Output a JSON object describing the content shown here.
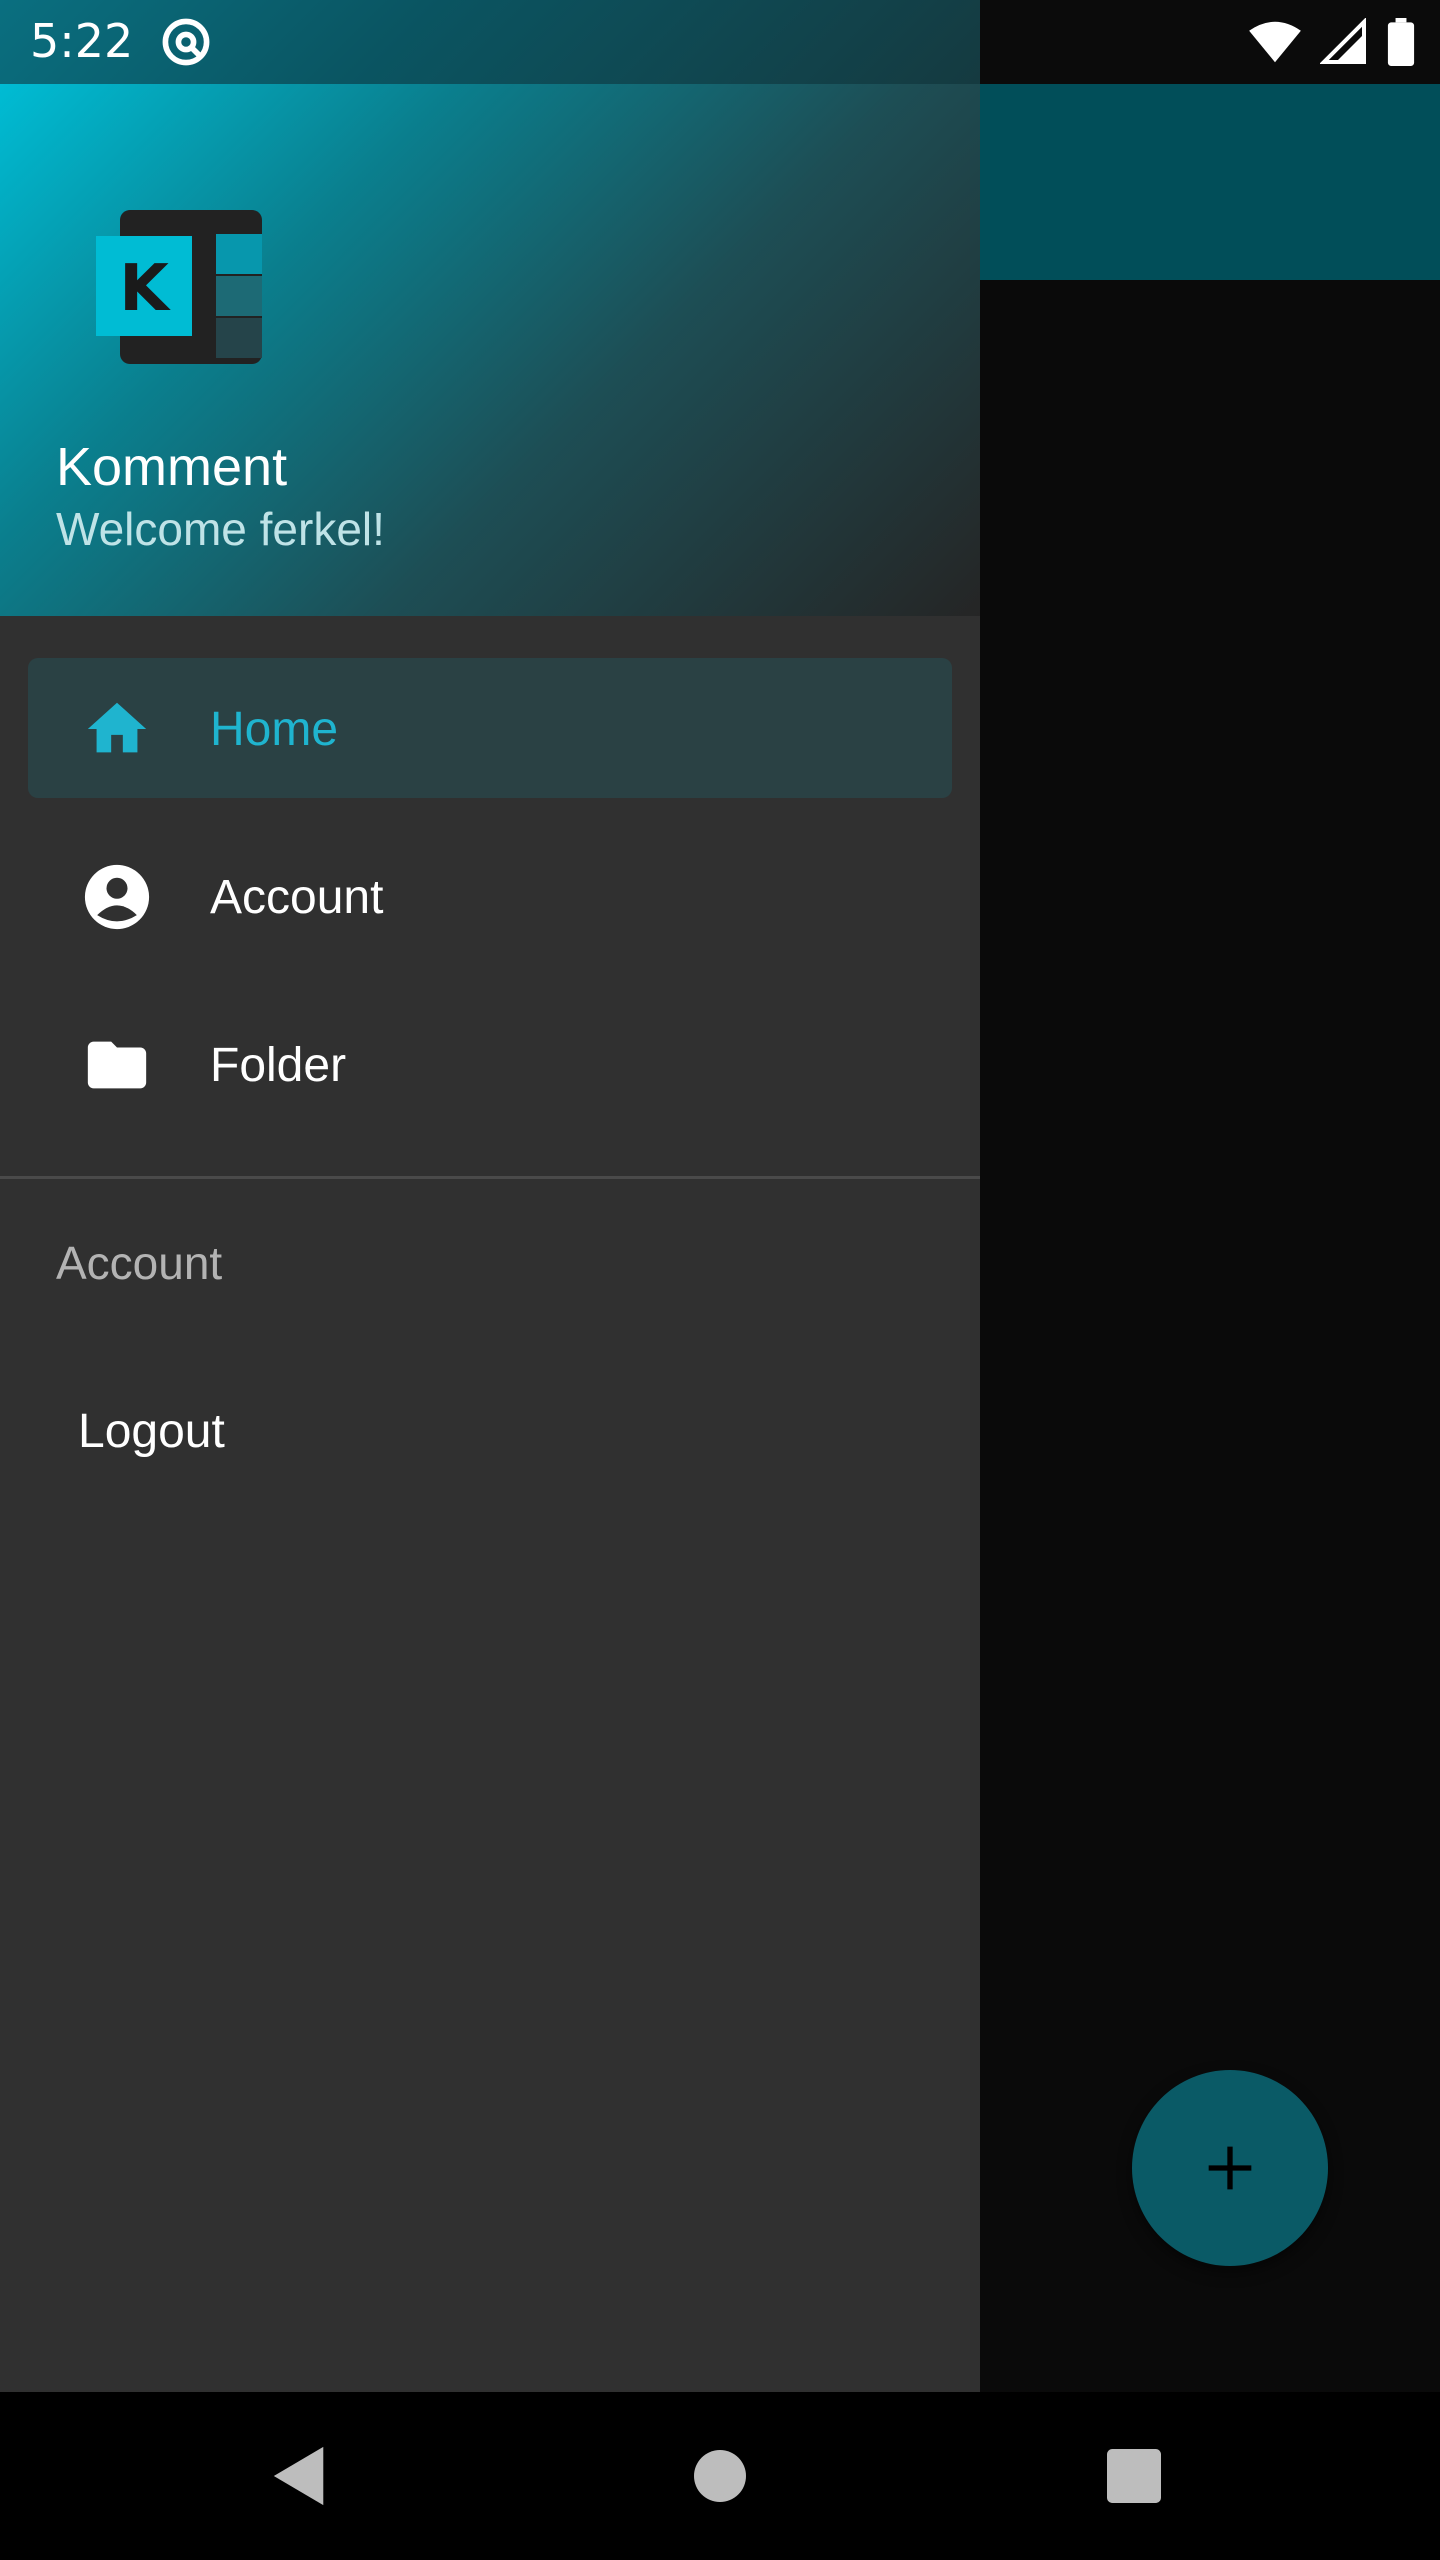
{
  "status_bar": {
    "time": "5:22",
    "icons": [
      "app-notification-icon",
      "wifi-icon",
      "cell-signal-icon",
      "battery-icon"
    ]
  },
  "drawer": {
    "header": {
      "app_name": "Komment",
      "welcome": "Welcome ferkel!",
      "logo_letter": "K"
    },
    "items": [
      {
        "label": "Home",
        "icon": "home-icon",
        "selected": true
      },
      {
        "label": "Account",
        "icon": "account-circle-icon",
        "selected": false
      },
      {
        "label": "Folder",
        "icon": "folder-icon",
        "selected": false
      }
    ],
    "section": {
      "title": "Account",
      "items": [
        {
          "label": "Logout"
        }
      ]
    }
  },
  "fab": {
    "icon": "plus-icon"
  },
  "nav_bar": {
    "icons": [
      "back-icon",
      "home-circle-icon",
      "recents-icon"
    ]
  },
  "colors": {
    "accent": "#1fb4cf",
    "drawer_bg": "#303030",
    "toolbar": "#014e59",
    "fab": "#0a5a66"
  }
}
